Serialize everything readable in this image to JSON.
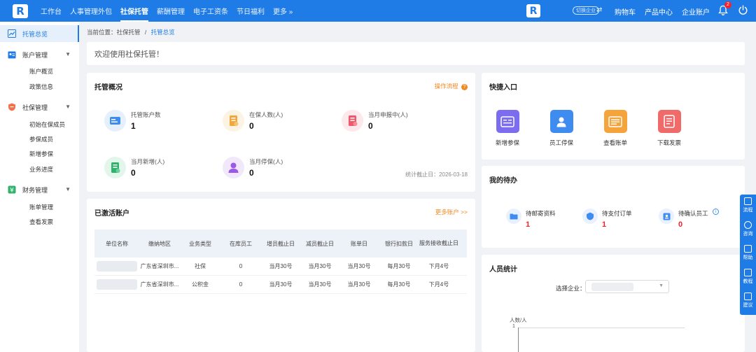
{
  "app": {
    "logo_text": "R",
    "nav": [
      "工作台",
      "人事管理外包",
      "社保托管",
      "薪酬管理",
      "电子工资条",
      "节日福利",
      "更多 »"
    ],
    "nav_active": 2,
    "switch_badge": "切换企业",
    "switch_icon": "⇄",
    "top_links": [
      "购物车",
      "产品中心",
      "企业账户"
    ],
    "notification_count": "2"
  },
  "sidebar": {
    "groups": [
      {
        "label": "托管总览",
        "icon": "trend-chart-icon",
        "active": true,
        "children": []
      },
      {
        "label": "账户管理",
        "icon": "account-card-icon",
        "children": [
          "账户概览",
          "政策信息"
        ]
      },
      {
        "label": "社保管理",
        "icon": "shield-icon",
        "children": [
          "初始在保成员",
          "参保成员",
          "新增参保",
          "业务进度"
        ]
      },
      {
        "label": "财务管理",
        "icon": "finance-yen-icon",
        "children": [
          "账单管理",
          "查看发票"
        ]
      }
    ]
  },
  "breadcrumb": {
    "prefix": "当前位置：社保托管",
    "sep": "/",
    "current": "托管总览"
  },
  "welcome": "欢迎使用社保托管！",
  "overview": {
    "title": "托管概况",
    "help_link": "操作流程",
    "stats": [
      {
        "label": "托管账户数",
        "value": "1",
        "color": "#3f8cf0",
        "bg": "#e6effc"
      },
      {
        "label": "在保人数(人)",
        "value": "0",
        "color": "#f2a73b",
        "bg": "#fdf3e3"
      },
      {
        "label": "当月申报中(人)",
        "value": "0",
        "color": "#ee5a6c",
        "bg": "#fde8eb"
      },
      {
        "label": "当月新增(人)",
        "value": "0",
        "color": "#2fb36c",
        "bg": "#e3f6ec"
      },
      {
        "label": "当月停保(人)",
        "value": "0",
        "color": "#9b59e6",
        "bg": "#f1e8fc"
      }
    ],
    "date_note": "统计截止日：2026-03-18"
  },
  "activated": {
    "title": "已激活账户",
    "more_link": "更多账户 >>",
    "headers": [
      "单位名称",
      "缴纳地区",
      "业务类型",
      "在库员工",
      "增员截止日",
      "减员截止日",
      "账单日",
      "银行扣款日",
      "服务接收截止日"
    ],
    "rows": [
      [
        "",
        "广东省深圳市...",
        "社保",
        "0",
        "当月30号",
        "当月30号",
        "当月30号",
        "每月30号",
        "下月4号"
      ],
      [
        "",
        "广东省深圳市...",
        "公积金",
        "0",
        "当月30号",
        "当月30号",
        "当月30号",
        "每月30号",
        "下月4号"
      ]
    ]
  },
  "quick": {
    "title": "快捷入口",
    "items": [
      {
        "label": "新增参保",
        "color": "#7b6cf0"
      },
      {
        "label": "员工停保",
        "color": "#3f8cf0"
      },
      {
        "label": "查看账单",
        "color": "#f5a43c"
      },
      {
        "label": "下载发票",
        "color": "#f06a6a"
      }
    ]
  },
  "todo": {
    "title": "我的待办",
    "items": [
      {
        "label": "待邮寄资料",
        "value": "1"
      },
      {
        "label": "待支付订单",
        "value": "1"
      },
      {
        "label": "待确认员工",
        "value": "0"
      }
    ]
  },
  "staff": {
    "title": "人员统计",
    "select_label": "选择企业：",
    "y_axis_label": "人数/人",
    "y_tick": "1"
  },
  "floatbar": [
    "流程",
    "咨询",
    "帮助",
    "教程",
    "建议"
  ]
}
